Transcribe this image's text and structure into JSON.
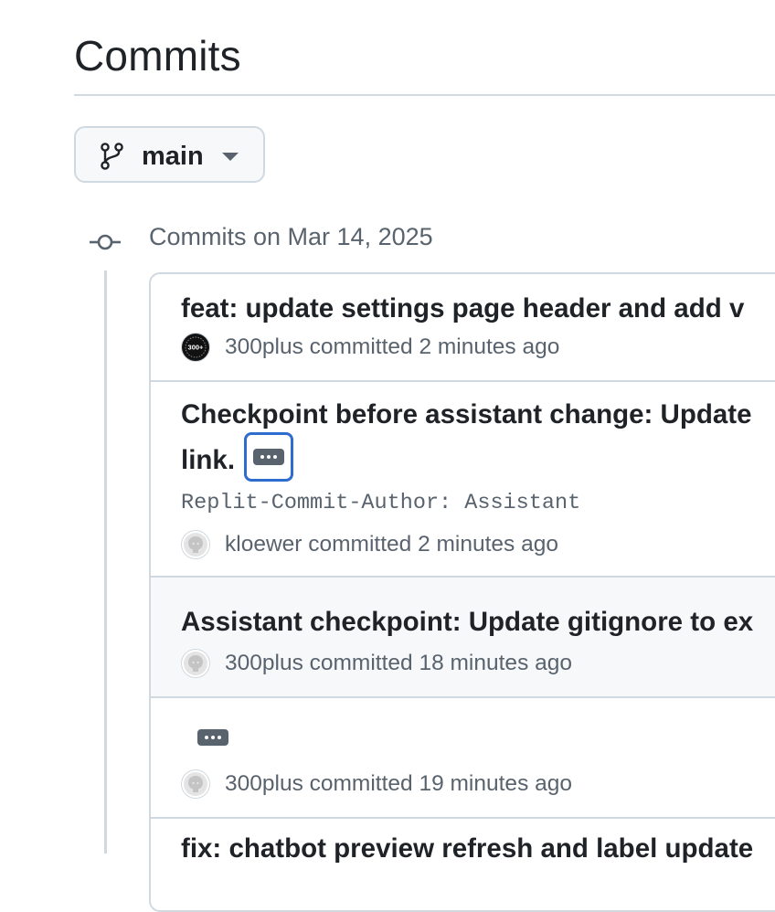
{
  "page": {
    "title": "Commits"
  },
  "branch": {
    "name": "main"
  },
  "group": {
    "date_label": "Commits on Mar 14, 2025"
  },
  "commits": [
    {
      "title": "feat: update settings page header and add v",
      "author": "300plus",
      "action": "committed",
      "time": "2 minutes ago",
      "avatar": "300plus-logo-avatar"
    },
    {
      "title_line1": "Checkpoint before assistant change: Update",
      "title_line2": "link.",
      "body": "Replit-Commit-Author: Assistant",
      "author": "kloewer",
      "action": "committed",
      "time": "2 minutes ago",
      "avatar": "github-octocat-avatar"
    },
    {
      "title": "Assistant checkpoint: Update gitignore to ex",
      "author": "300plus",
      "action": "committed",
      "time": "18 minutes ago",
      "avatar": "github-octocat-avatar"
    },
    {
      "title": "",
      "author": "300plus",
      "action": "committed",
      "time": "19 minutes ago",
      "avatar": "github-octocat-avatar"
    },
    {
      "title": "fix: chatbot preview refresh and label update"
    }
  ],
  "colors": {
    "border": "#d1d9e0",
    "muted_text": "#59636e",
    "focus_ring": "#2f6ccf",
    "hover_row": "#f6f8fa"
  }
}
